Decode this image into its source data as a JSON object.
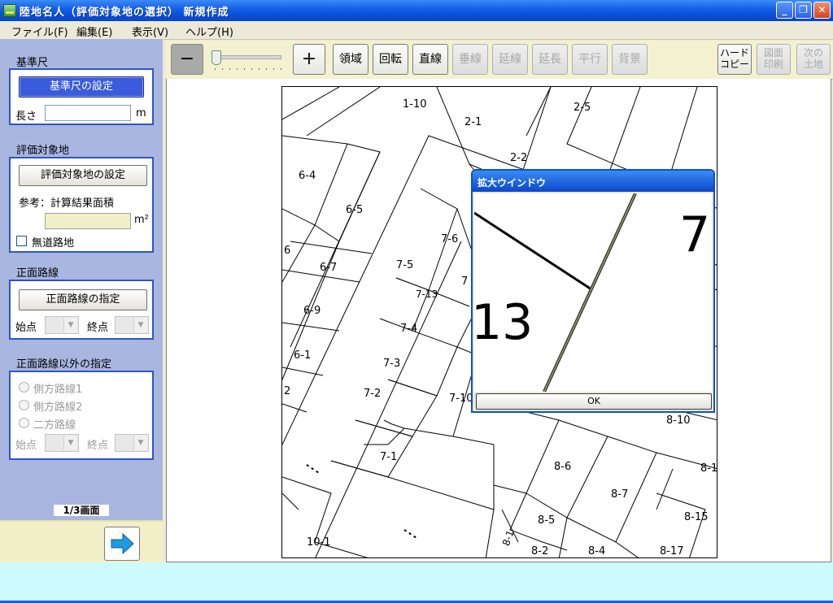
{
  "window": {
    "title": "陸地名人（評価対象地の選択） 新規作成",
    "controls": {
      "minimize": "_",
      "maximize": "❐",
      "close": "✕"
    }
  },
  "menu": [
    "ファイル(F)",
    "編集(E)",
    "表示(V)",
    "ヘルプ(H)"
  ],
  "left": {
    "scale": {
      "title": "基準尺",
      "button": "基準尺の設定",
      "length_label": "長さ",
      "length_value": "",
      "unit": "m"
    },
    "target": {
      "title": "評価対象地",
      "button": "評価対象地の設定",
      "ref_label": "参考：計算結果面積",
      "area_value": "",
      "area_unit": "m²",
      "no_road_label": "無道路地"
    },
    "front": {
      "title": "正面路線",
      "button": "正面路線の指定",
      "start_label": "始点",
      "end_label": "終点"
    },
    "other": {
      "title": "正面路線以外の指定",
      "options": [
        "側方路線1",
        "側方路線2",
        "二方路線"
      ],
      "start_label": "始点",
      "end_label": "終点"
    },
    "page_info": "1/3画面"
  },
  "toolbar": {
    "zoom_out": "−",
    "zoom_in": "+",
    "zoom_level": 0,
    "buttons": [
      "領域",
      "回転",
      "直線",
      "垂線",
      "延線",
      "延長",
      "平行",
      "背景"
    ],
    "right_buttons": [
      {
        "line1": "ハード",
        "line2": "コピー"
      },
      {
        "line1": "図面",
        "line2": "印刷"
      },
      {
        "line1": "次の",
        "line2": "土地"
      }
    ]
  },
  "map": {
    "parcels": [
      "1-10",
      "2-1",
      "2-5",
      "2-2",
      "6-4",
      "6-5",
      "7-6",
      "6",
      "6-7",
      "7-5",
      "7-13",
      "7",
      "6-9",
      "7-4",
      "6-1",
      "7-3",
      "2",
      "7-2",
      "7-10",
      "8-10",
      "7-1",
      "8-6",
      "8-1",
      "8-7",
      "8-5",
      "8-15",
      "8-1",
      "8-2",
      "8-4",
      "8-17",
      "10-1"
    ]
  },
  "zoom_window": {
    "title": "拡大ウインドウ",
    "big_left": "13",
    "big_right": "7-",
    "ok": "OK"
  }
}
